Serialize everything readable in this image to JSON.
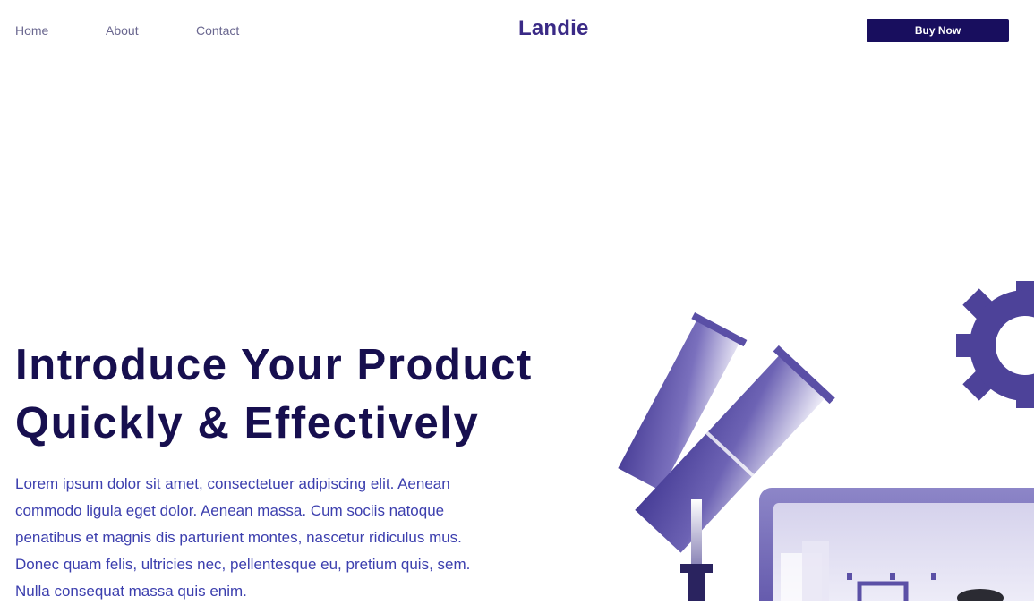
{
  "nav": {
    "links": [
      {
        "label": "Home"
      },
      {
        "label": "About"
      },
      {
        "label": "Contact"
      }
    ],
    "brand": "Landie",
    "cta_label": "Buy Now"
  },
  "hero": {
    "title_line1": "Introduce Your Product",
    "title_line2": "Quickly & Effectively",
    "paragraph": "Lorem ipsum dolor sit amet, consectetuer adipiscing elit. Aenean commodo ligula eget dolor. Aenean massa. Cum sociis natoque penatibus et magnis dis parturient montes, nascetur ridiculus mus. Donec quam felis, ultricies nec, pellentesque eu, pretium quis, sem. Nulla consequat massa quis enim."
  },
  "colors": {
    "brand": "#3a2a86",
    "cta_background": "#180e5e",
    "title": "#170f4f",
    "body_text": "#3c3fae",
    "illustration_primary": "#5b50a6"
  },
  "icons": [
    "telescope-illustration",
    "gear-icon",
    "monitor-illustration"
  ]
}
